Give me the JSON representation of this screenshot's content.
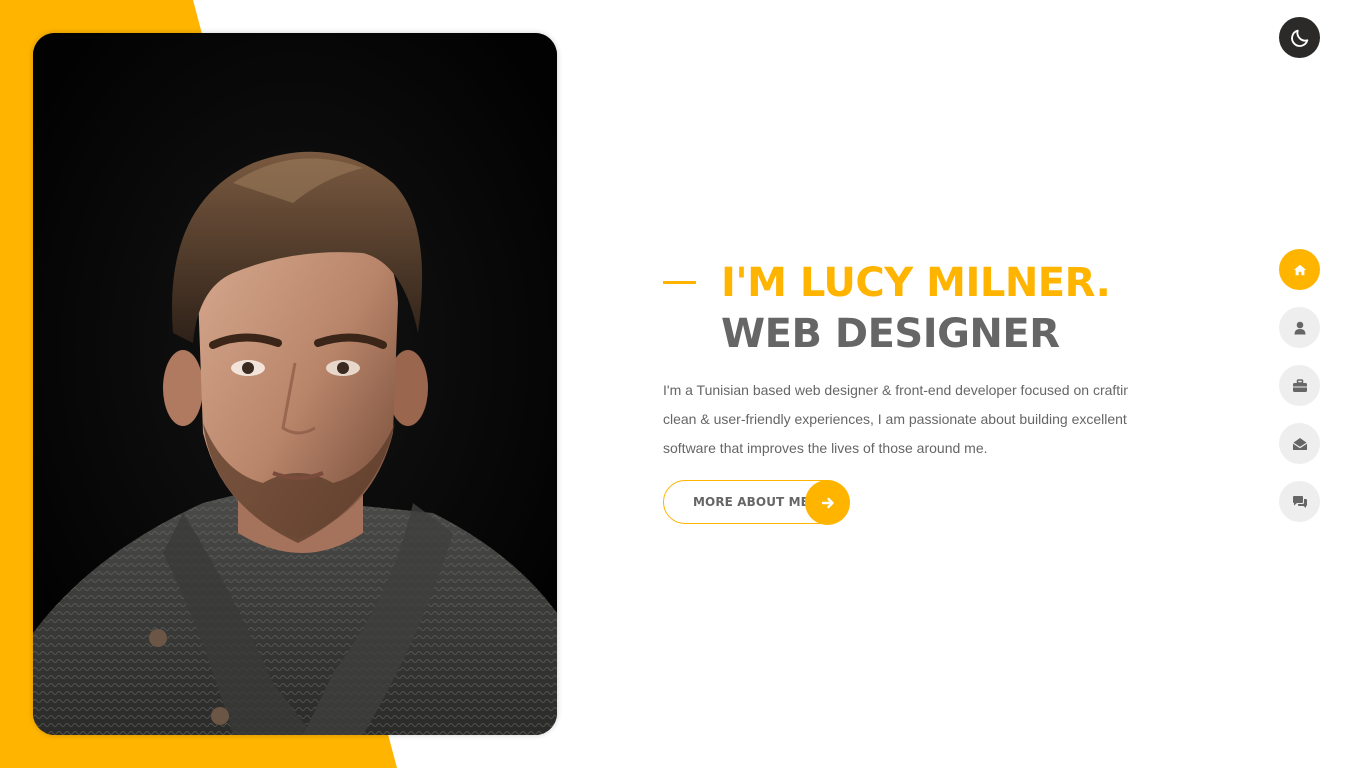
{
  "colors": {
    "accent": "#ffb400",
    "text": "#666666",
    "dark": "#2b2a29",
    "nav_inactive": "#eeeeee"
  },
  "theme_toggle": {
    "icon": "moon-icon"
  },
  "hero": {
    "name": "I'M LUCY MILNER.",
    "role": "WEB DESIGNER",
    "description_lines": [
      "I'm a Tunisian based web designer & front-end developer focused on craftin",
      "clean & user-friendly experiences, I am passionate about building excellent",
      "software that improves the lives of those around me."
    ],
    "button_label": "MORE ABOUT ME",
    "button_icon": "arrow-right-icon"
  },
  "portrait": {
    "alt": "portrait-photo"
  },
  "side_nav": {
    "items": [
      {
        "icon": "home-icon",
        "active": true
      },
      {
        "icon": "user-icon",
        "active": false
      },
      {
        "icon": "briefcase-icon",
        "active": false
      },
      {
        "icon": "envelope-open-icon",
        "active": false
      },
      {
        "icon": "comments-icon",
        "active": false
      }
    ]
  }
}
